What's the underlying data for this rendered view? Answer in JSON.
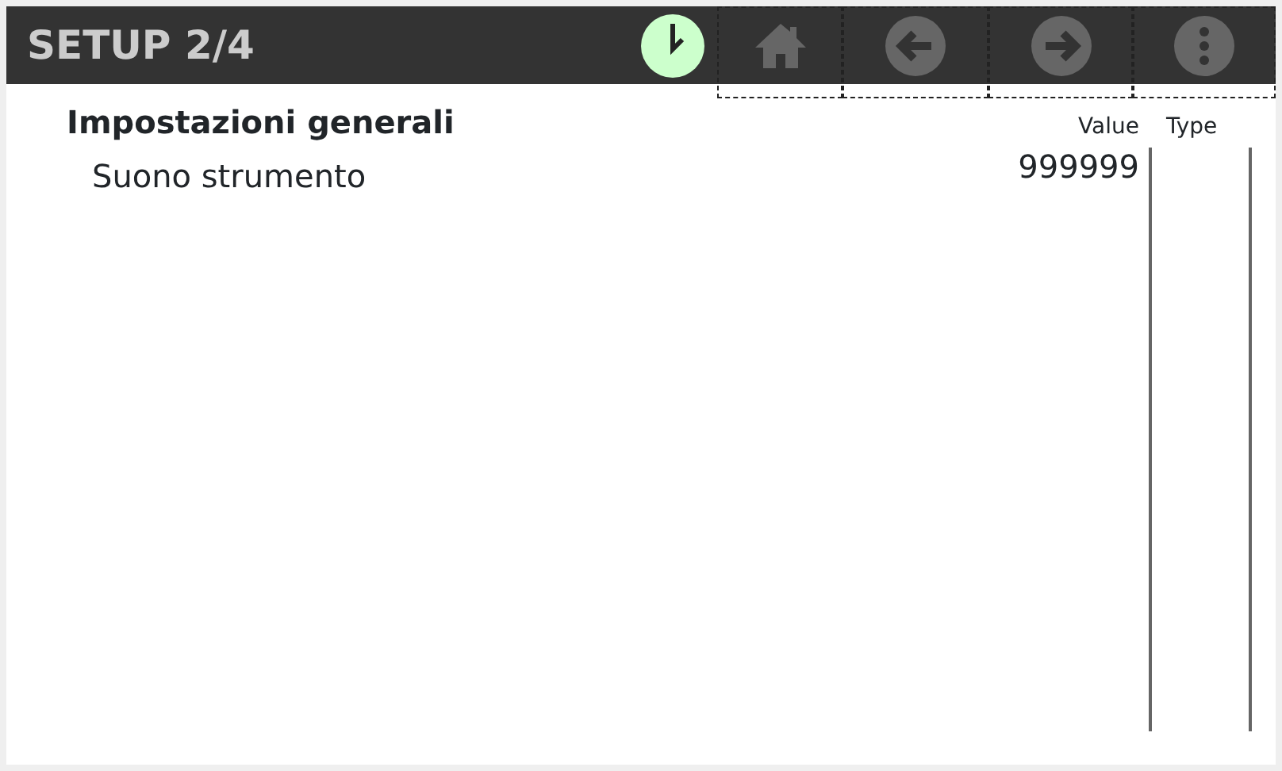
{
  "header": {
    "title": "SETUP 2/4"
  },
  "toolbar": [
    {
      "kind": "home"
    },
    {
      "kind": "back"
    },
    {
      "kind": "forward"
    },
    {
      "kind": "menu"
    }
  ],
  "section": {
    "title": "Impostazioni generali"
  },
  "columns": [
    "Value",
    "Type"
  ],
  "rows": [
    {
      "label": "Suono strumento",
      "value": "999999"
    }
  ]
}
